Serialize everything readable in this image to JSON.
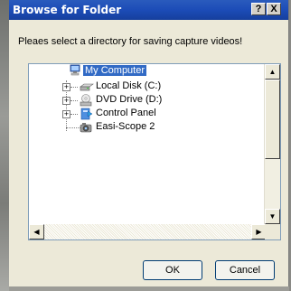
{
  "window": {
    "title": "Browse for Folder",
    "help_label": "?",
    "close_label": "X"
  },
  "prompt": "Pleaes select a directory for saving capture videos!",
  "tree": {
    "items": [
      {
        "label": "My Computer",
        "icon": "computer-icon",
        "selected": true
      },
      {
        "label": "Local Disk (C:)",
        "icon": "hard-drive-icon",
        "expander": "+"
      },
      {
        "label": "DVD Drive (D:)",
        "icon": "dvd-drive-icon",
        "expander": "+"
      },
      {
        "label": "Control Panel",
        "icon": "control-panel-icon",
        "expander": "+"
      },
      {
        "label": "Easi-Scope 2",
        "icon": "camera-device-icon"
      }
    ]
  },
  "scroll": {
    "up_arrow": "▲",
    "down_arrow": "▼",
    "left_arrow": "◀",
    "right_arrow": "▶"
  },
  "buttons": {
    "ok": "OK",
    "cancel": "Cancel"
  },
  "colors": {
    "titlebar": "#1c4cb7",
    "selection": "#316ac5",
    "dialog_bg": "#ece9d8"
  }
}
